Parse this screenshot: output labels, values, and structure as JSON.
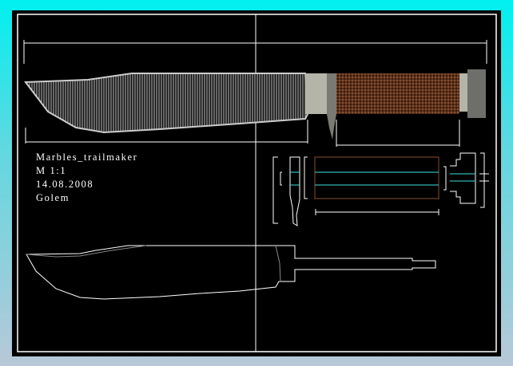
{
  "title_block": {
    "name": "Marbles_trailmaker",
    "scale": "M 1:1",
    "date": "14.08.2008",
    "author": "Golem"
  },
  "colors": {
    "background_top": "#00f0f0",
    "sheet": "#000000",
    "line": "#ffffff",
    "handle": "#6a3a22",
    "guard": "#b4b4a8",
    "pommel": "#6e6e6a",
    "center_line": "#40d0d0"
  }
}
